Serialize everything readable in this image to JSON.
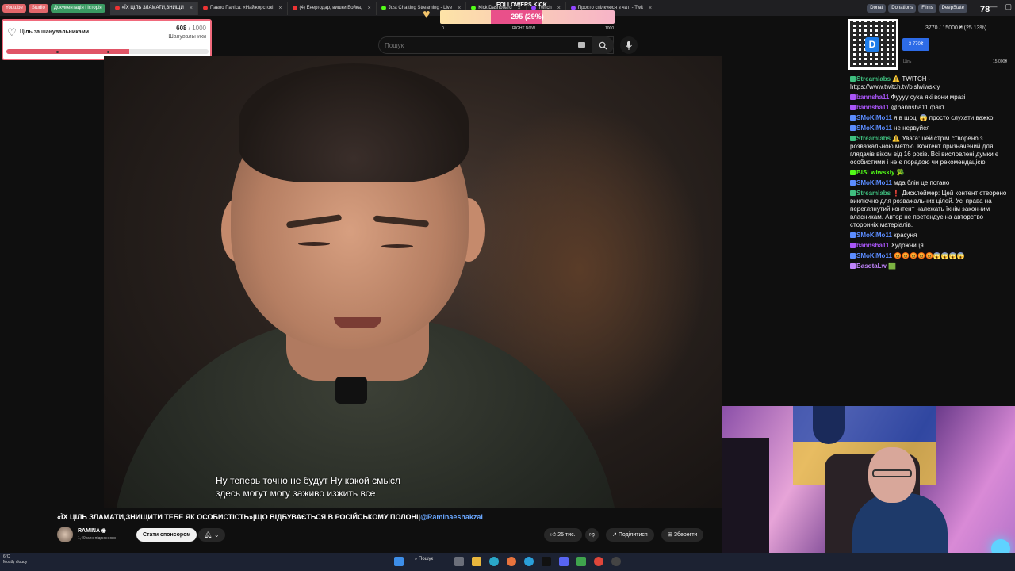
{
  "browser": {
    "bookmarks": [
      {
        "label": "Youtube",
        "color": "#e1666a"
      },
      {
        "label": "Studio",
        "color": "#e1666a"
      },
      {
        "label": "Документація і історія",
        "color": "#3a9a62"
      }
    ],
    "tabs": [
      {
        "label": "«ЇХ ЦІЛЬ ЗЛАМАТИ,ЗНИЩИ",
        "active": true,
        "color": "#e33"
      },
      {
        "label": "Павло Паліса: «Найжорстокі",
        "active": false,
        "color": "#e33"
      },
      {
        "label": "(4) Енергодар, вишки Бойка,",
        "active": false,
        "color": "#e33"
      },
      {
        "label": "Just Chatting Streaming - Live",
        "active": false,
        "color": "#53fc18"
      },
      {
        "label": "Kick Dashboard",
        "active": false,
        "color": "#53fc18"
      },
      {
        "label": "Twitch",
        "active": false,
        "color": "#9146ff"
      },
      {
        "label": "Просто спілкуюся в чаті - Twit",
        "active": false,
        "color": "#9146ff"
      }
    ],
    "right_bookmarks": [
      "Donat",
      "Donations",
      "Films",
      "DeepState"
    ]
  },
  "goal_widget": {
    "title": "Ціль за шанувальниками",
    "current": "608",
    "total": "/ 1000",
    "subtitle": "Шанувальники",
    "progress": 0.608
  },
  "kick_widget": {
    "title": "FOLLOWERS KICK",
    "value_text": "295 (29%)",
    "progress": 0.295,
    "min_label": "0",
    "mid_label": "RIGHT NOW",
    "max_label": "1000"
  },
  "viewer_count": "78",
  "search": {
    "placeholder": "Пошук"
  },
  "video": {
    "subtitle_line1": "Ну теперь точно не будут Ну какой смысл",
    "subtitle_line2": "здесь могут могу заживо изжить все"
  },
  "video_info": {
    "title": "«ЇХ ЦІЛЬ ЗЛАМАТИ,ЗНИЩИТИ ТЕБЕ ЯК ОСОБИСТІСТЬ»|ЩО ВІДБУВАЄТЬСЯ В РОСІЙСЬКОМУ ПОЛОНІ|",
    "tag": "@Raminaeshakzai",
    "channel": "RAMINA",
    "subscribers": "1,49 млн підписників",
    "sponsor_label": "Стати спонсором",
    "likes": "25 тис.",
    "share_label": "Поділитися",
    "save_label": "Зберегти"
  },
  "donation": {
    "progress_text": "3770 / 15000 ₴ (25.13%)",
    "button_label": "3 770₴",
    "left_label": "Ціль",
    "right_label": "15 000₴"
  },
  "chat": [
    {
      "user": "Streamlabs",
      "color": "#3fbf7f",
      "text": "⚠️ TWITCH - https://www.twitch.tv/bislwiwskiy"
    },
    {
      "user": "bannsha11",
      "color": "#a855f7",
      "text": "Фуууу сука які вони мразі"
    },
    {
      "user": "bannsha11",
      "color": "#a855f7",
      "text": "@bannsha11 факт"
    },
    {
      "user": "SMoKiMo11",
      "color": "#5b8cff",
      "text": "я в шоці 😱 просто слухати важко"
    },
    {
      "user": "SMoKiMo11",
      "color": "#5b8cff",
      "text": "не нервуйся"
    },
    {
      "user": "Streamlabs",
      "color": "#3fbf7f",
      "text": "⚠️ Увага: цей стрім створено з розважальною метою. Контент призначений для глядачів віком від 16 років. Всі висловлені думки є особистими і не є порадою чи рекомендацією."
    },
    {
      "user": "BISLwiwskiy",
      "color": "#53fc18",
      "text": "🥦"
    },
    {
      "user": "SMoKiMo11",
      "color": "#5b8cff",
      "text": "мда блін це погано"
    },
    {
      "user": "Streamlabs",
      "color": "#3fbf7f",
      "text": "❗ Дисклеймер: Цей контент створено виключно для розважальних цілей. Усі права на переглянутий контент належать їхнім законним власникам. Автор не претендує на авторство сторонніх матеріалів."
    },
    {
      "user": "SMoKiMo11",
      "color": "#5b8cff",
      "text": "красуня"
    },
    {
      "user": "bannsha11",
      "color": "#a855f7",
      "text": "Художниця"
    },
    {
      "user": "SMoKiMo11",
      "color": "#5b8cff",
      "text": "😡😡😡😡😡😱😱😱😱"
    },
    {
      "user": "BasotaLw",
      "color": "#c084fc",
      "text": "🟩"
    }
  ],
  "taskbar": {
    "temp": "6°C",
    "weather": "Mostly cloudy",
    "search_label": "Пошук"
  }
}
